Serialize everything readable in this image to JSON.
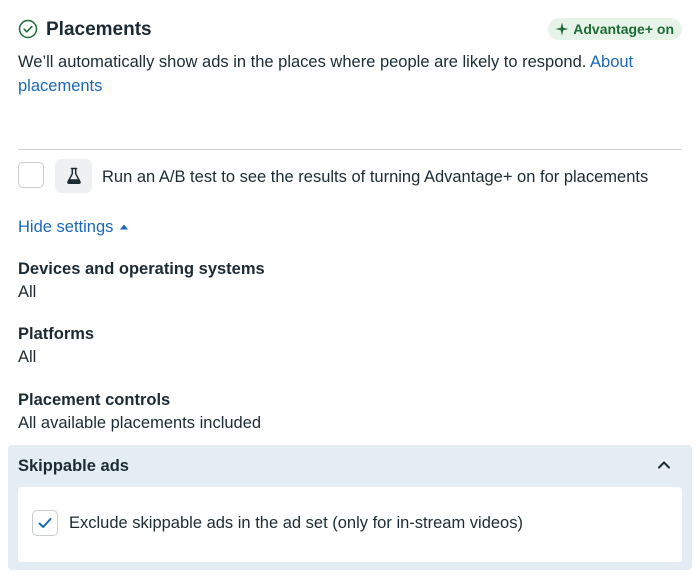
{
  "header": {
    "title": "Placements",
    "status_icon": "check-circle-icon",
    "badge_icon": "sparkle-icon",
    "badge_label": "Advantage+ on"
  },
  "description": {
    "text": "We’ll automatically show ads in the places where people are likely to respond. ",
    "link": "About placements"
  },
  "ab_test": {
    "checked": false,
    "icon": "flask-icon",
    "label": "Run an A/B test to see the results of turning Advantage+ on for placements"
  },
  "settings_toggle": {
    "label": "Hide settings",
    "icon": "caret-up-icon"
  },
  "settings": [
    {
      "title": "Devices and operating systems",
      "value": "All"
    },
    {
      "title": "Platforms",
      "value": "All"
    },
    {
      "title": "Placement controls",
      "value": "All available placements included"
    }
  ],
  "skippable_ads": {
    "title": "Skippable ads",
    "collapse_icon": "chevron-up-icon",
    "option_label": "Exclude skippable ads in the ad set (only for in-stream videos)",
    "checked": true
  },
  "colors": {
    "link": "#1b68b8",
    "badge_bg": "#e7f3e8",
    "badge_text": "#1d6b36",
    "panel_bg": "#e4edf4",
    "text": "#1c2b33"
  }
}
